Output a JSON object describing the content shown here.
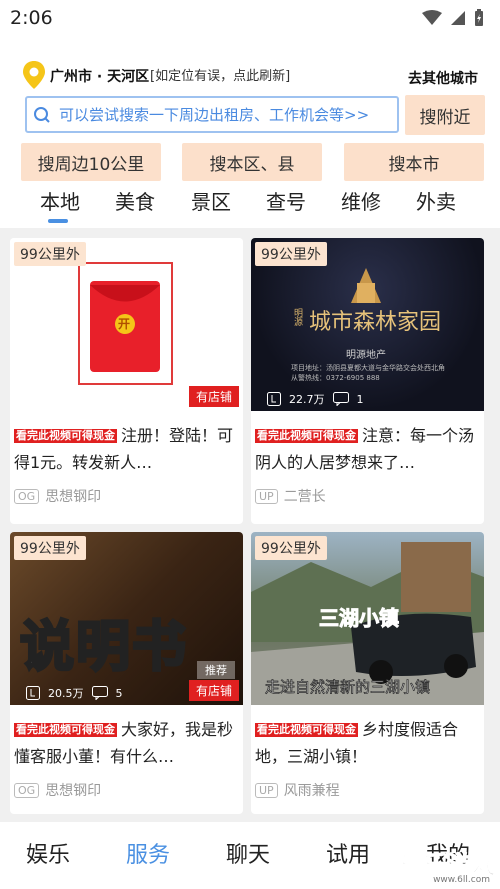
{
  "status": {
    "time": "2:06"
  },
  "location": {
    "city": "广州市 · 天河区",
    "hint": "[如定位有误，点此刷新]",
    "other_city": "去其他城市"
  },
  "search": {
    "placeholder": "可以尝试搜索一下周边出租房、工作机会等>>",
    "nearby_label": "搜附近"
  },
  "chips": [
    "搜周边10公里",
    "搜本区、县",
    "搜本市"
  ],
  "tabs": [
    "本地",
    "美食",
    "景区",
    "查号",
    "维修",
    "外卖"
  ],
  "active_tab": "本地",
  "cards": [
    {
      "distance": "99公里外",
      "promo": "看完此视频可得现金",
      "title": "注册！登陆！可得1元。转发新人…",
      "author": "思想钢印",
      "author_badge": "OG",
      "shop_badge": "有店铺",
      "thumb_text": "开"
    },
    {
      "distance": "99公里外",
      "promo": "看完此视频可得现金",
      "title": "注意：每一个汤阴人的人居梦想来了…",
      "author": "二营长",
      "author_badge": "UP",
      "views": "22.7万",
      "comments": "1",
      "thumb_title": "城市森林家园",
      "thumb_brand": "明源",
      "thumb_sub": "明源地产",
      "thumb_addr": "项目地址：汤阴县夏都大道与金华路交会处西北角",
      "thumb_phone": "从警热线：0372-6905 888"
    },
    {
      "distance": "99公里外",
      "promo": "看完此视频可得现金",
      "title": "大家好，我是秒懂客服小董！有什么…",
      "author": "思想钢印",
      "author_badge": "OG",
      "views": "20.5万",
      "comments": "5",
      "shop_badge": "有店铺",
      "recommend": "推荐",
      "thumb_text": "说明书"
    },
    {
      "distance": "99公里外",
      "promo": "看完此视频可得现金",
      "title": "乡村度假适合地，三湖小镇！",
      "author": "风雨兼程",
      "author_badge": "UP",
      "thumb_title": "三湖小镇",
      "thumb_caption": "走进自然清新的三湖小镇"
    }
  ],
  "bottom_nav": [
    "娱乐",
    "服务",
    "聊天",
    "试用",
    "我的"
  ],
  "active_nav": "服务",
  "watermark": {
    "text": "乐乐游戏",
    "url": "www.6ll.com"
  },
  "colors": {
    "accent": "#4a90e2",
    "chip_bg": "#fce0cb",
    "promo_red": "#e02020",
    "feed_bg": "#f0f0f0"
  }
}
